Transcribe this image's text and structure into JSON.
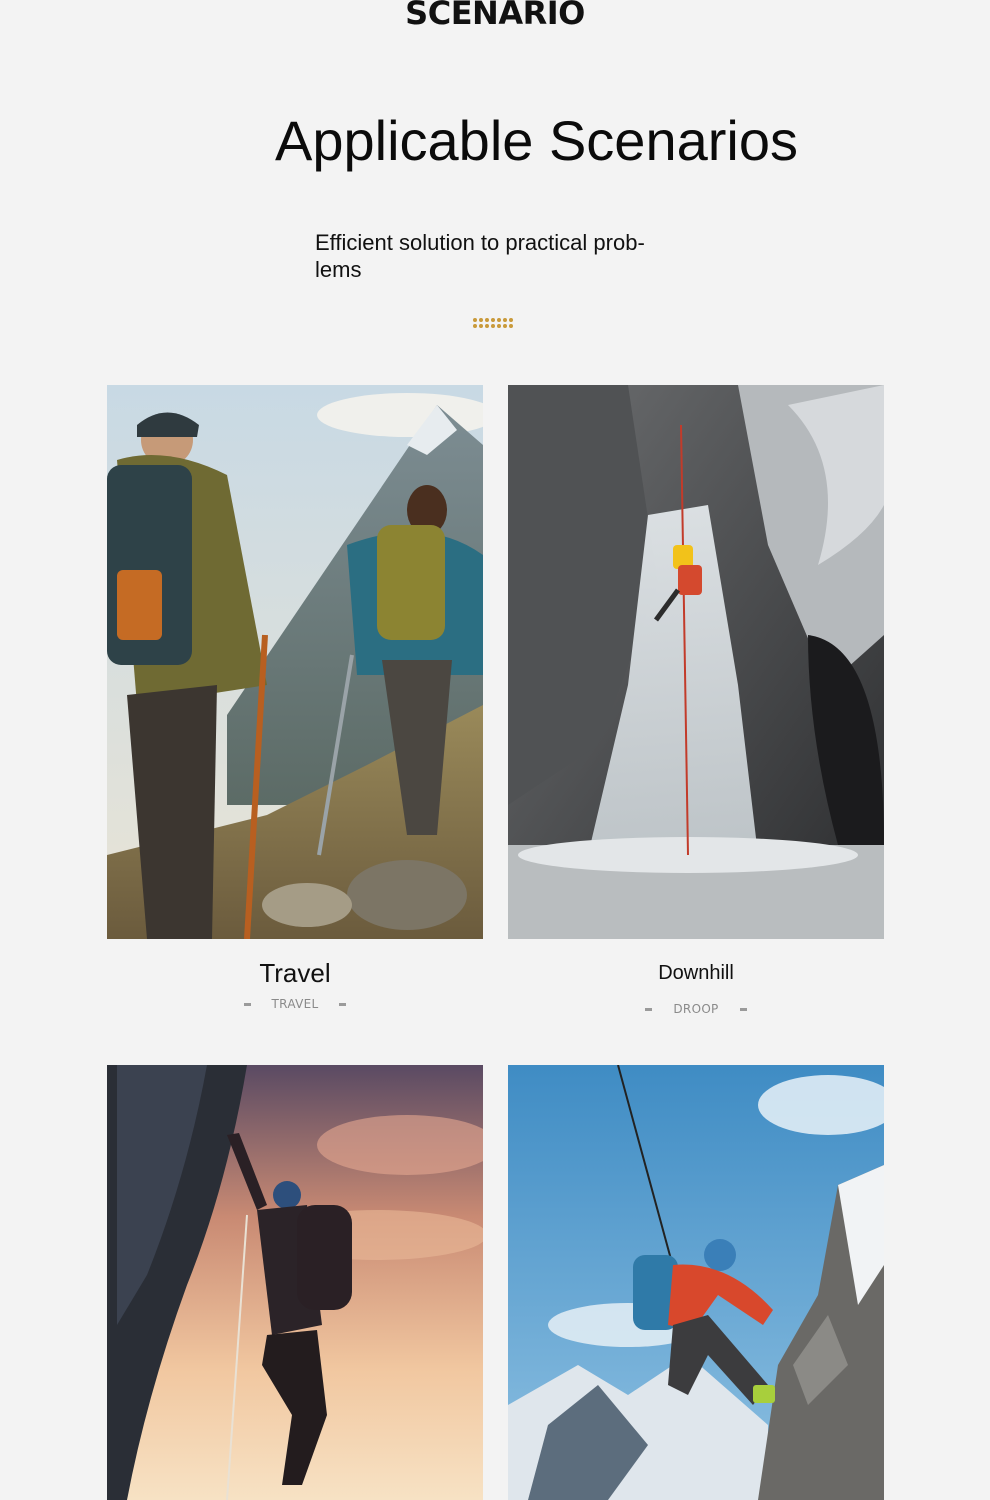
{
  "header": {
    "brand": "SCENARIO",
    "title": "Applicable Scenarios",
    "subtitle": "Efficient solution to practical prob- lems"
  },
  "accent_color": "#c99a3a",
  "scenarios": [
    {
      "title": "Travel",
      "subtitle": "TRAVEL",
      "image": "hikers-with-trekking-poles-mountain"
    },
    {
      "title": "Downhill",
      "subtitle": "DROOP",
      "image": "climber-rappelling-waterfall"
    },
    {
      "title": "",
      "subtitle": "",
      "image": "rock-climber-sunset"
    },
    {
      "title": "",
      "subtitle": "",
      "image": "alpine-climber-snowy-peaks"
    }
  ]
}
